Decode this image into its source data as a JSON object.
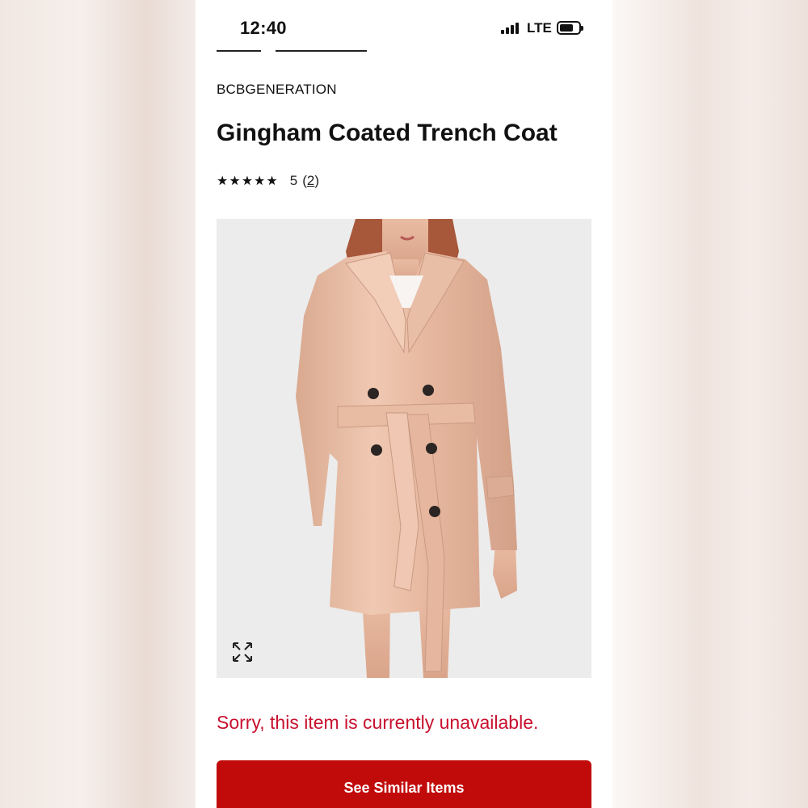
{
  "status_bar": {
    "time": "12:40",
    "network": "LTE"
  },
  "product": {
    "brand": "BCBGENERATION",
    "title": "Gingham Coated Trench Coat",
    "rating": {
      "stars": "★★★★★",
      "value": "5",
      "count_open": "(",
      "count": "2",
      "count_close": ")"
    },
    "image_icon": "expand-icon"
  },
  "availability": {
    "message": "Sorry, this item is currently unavailable."
  },
  "actions": {
    "similar_label": "See Similar Items",
    "button_color": "#c10b0b"
  },
  "colors": {
    "error_text": "#c8102e",
    "text": "#111111"
  }
}
